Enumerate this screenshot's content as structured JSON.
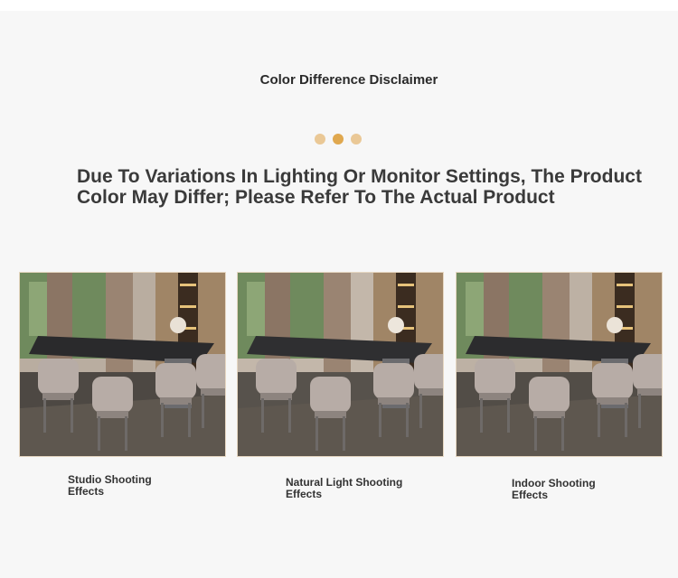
{
  "header": {
    "title": "Color Difference Disclaimer",
    "dot_colors": [
      "#eac896",
      "#e0a84f",
      "#eac896"
    ]
  },
  "headline": {
    "line1": "Due To Variations In Lighting Or Monitor Settings, The Product",
    "line2": "Color May Differ; Please Refer To The Actual Product"
  },
  "photos": [
    {
      "caption_line1": "Studio Shooting",
      "caption_line2": "Effects"
    },
    {
      "caption_line1": "Natural Light Shooting",
      "caption_line2": "Effects"
    },
    {
      "caption_line1": "Indoor Shooting",
      "caption_line2": "Effects"
    }
  ]
}
